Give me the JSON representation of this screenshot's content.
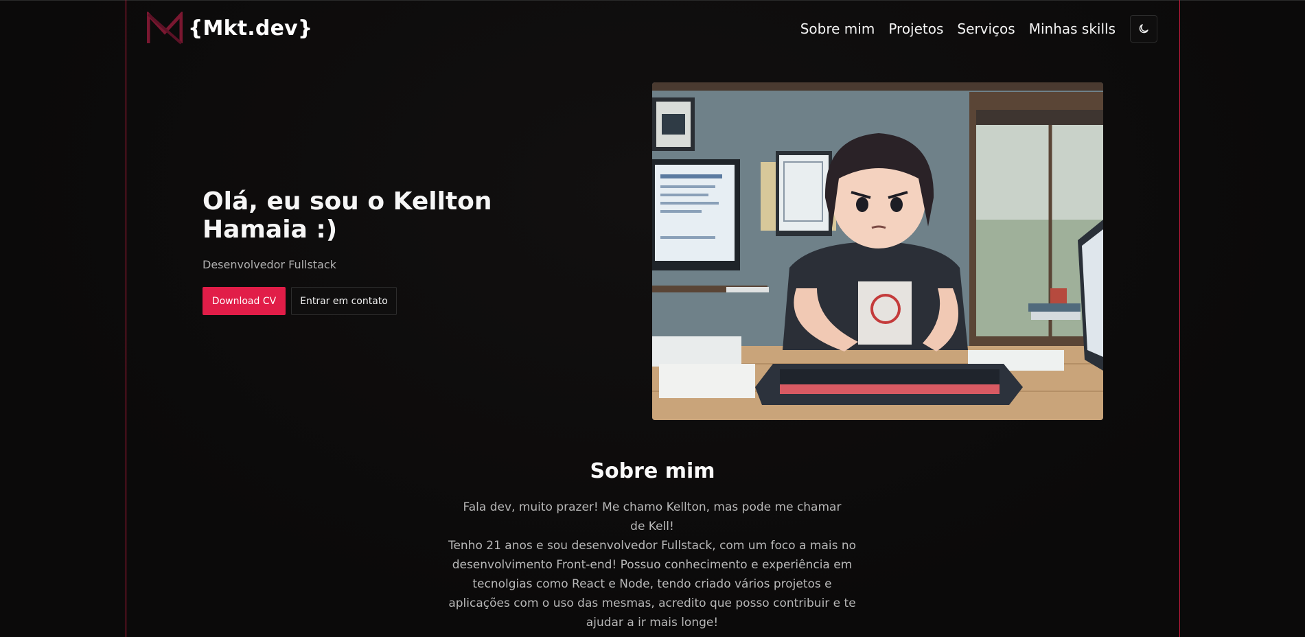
{
  "brand": {
    "logo_text": "{Mkt.dev}",
    "accent": "#e11d48",
    "logo_mark_color": "#7a1730"
  },
  "nav": {
    "items": [
      {
        "label": "Sobre mim"
      },
      {
        "label": "Projetos"
      },
      {
        "label": "Serviços"
      },
      {
        "label": "Minhas skills"
      }
    ],
    "theme_toggle_icon": "moon-icon"
  },
  "hero": {
    "title": "Olá, eu sou o Kellton Hamaia :)",
    "subtitle": "Desenvolvedor Fullstack",
    "primary_button": "Download CV",
    "secondary_button": "Entrar em contato",
    "image_alt": "anime-programmer-illustration"
  },
  "about": {
    "title": "Sobre mim",
    "paragraph1": "Fala dev, muito prazer! Me chamo Kellton, mas pode me chamar de Kell!",
    "paragraph2": "Tenho 21 anos e sou desenvolvedor Fullstack, com um foco a mais no desenvolvimento Front-end! Possuo conhecimento e experiência em tecnolgias como React e Node, tendo criado vários projetos e aplicações com o uso das mesmas, acredito que posso contribuir e te ajudar a ir mais longe!"
  }
}
